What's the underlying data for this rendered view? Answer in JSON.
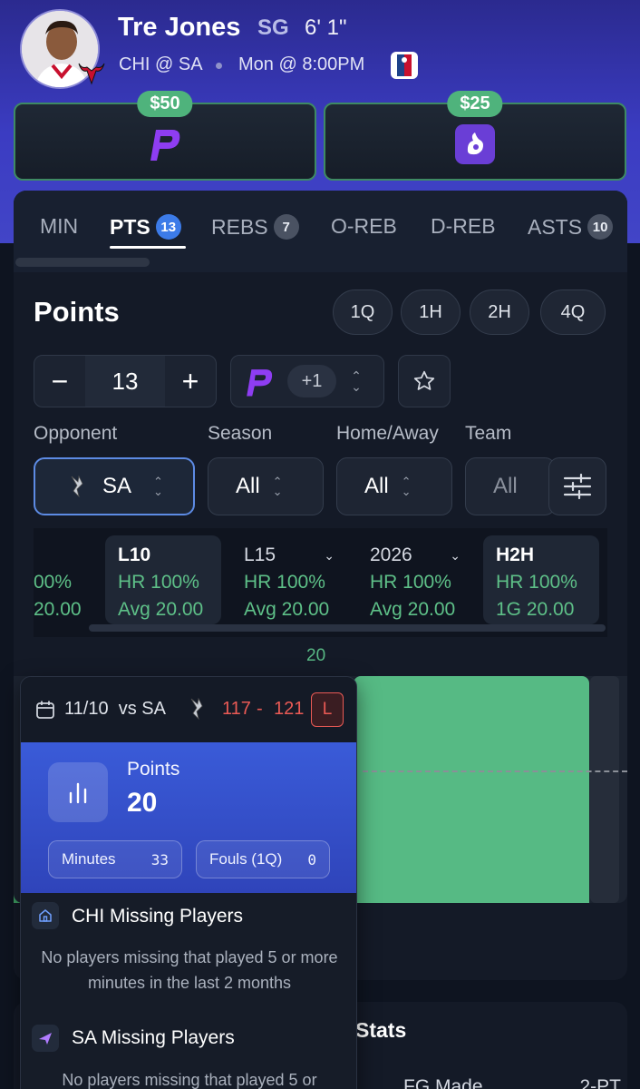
{
  "player": {
    "name": "Tre Jones",
    "position": "SG",
    "height": "6' 1\"",
    "matchup": "CHI @ SA",
    "game_time": "Mon @ 8:00PM"
  },
  "promos": [
    {
      "amount": "$50",
      "icon": "prizepicks-logo-icon"
    },
    {
      "amount": "$25",
      "icon": "underdog-logo-icon"
    }
  ],
  "tabs": [
    {
      "label": "MIN",
      "count": ""
    },
    {
      "label": "PTS",
      "count": "13"
    },
    {
      "label": "REBS",
      "count": "7"
    },
    {
      "label": "O-REB",
      "count": ""
    },
    {
      "label": "D-REB",
      "count": ""
    },
    {
      "label": "ASTS",
      "count": "10"
    }
  ],
  "section": {
    "title": "Points",
    "periods": [
      "1Q",
      "1H",
      "2H",
      "4Q"
    ]
  },
  "line": {
    "minus": "−",
    "value": "13",
    "plus": "+",
    "bump": "+1"
  },
  "filters": {
    "labels": [
      "Opponent",
      "Season",
      "Home/Away",
      "Team"
    ],
    "opponent": "SA",
    "season": "All",
    "home_away": "All",
    "team": "All"
  },
  "hit_rates": [
    {
      "title": "",
      "hr": "00%",
      "avg": "20.00"
    },
    {
      "title": "L10",
      "hr": "HR 100%",
      "avg": "Avg 20.00"
    },
    {
      "title": "L15",
      "hr": "HR 100%",
      "avg": "Avg 20.00"
    },
    {
      "title": "2026",
      "hr": "HR 100%",
      "avg": "Avg 20.00"
    },
    {
      "title": "H2H",
      "hr": "HR 100%",
      "avg": "1G 20.00"
    }
  ],
  "chart_data": {
    "type": "bar",
    "categories": [
      "11/10 vs SA"
    ],
    "values": [
      20
    ],
    "line": 13,
    "data_labels": [
      "20"
    ]
  },
  "tooltip": {
    "date": "11/10",
    "vs": "vs SA",
    "score_a": "117",
    "dash": "-",
    "score_b": "121",
    "result": "L",
    "stat_name": "Points",
    "stat_value": "20",
    "minutes_label": "Minutes",
    "minutes_value": "33",
    "fouls_label": "Fouls (1Q)",
    "fouls_value": "0",
    "chi_missing_title": "CHI Missing Players",
    "chi_missing_text": "No players missing that played 5 or more minutes in the last 2 months",
    "sa_missing_title": "SA Missing Players",
    "sa_missing_text": "No players missing that played 5 or"
  },
  "stats": {
    "title": "Stats",
    "row_label": "FG Made",
    "row_right": "2-PT"
  },
  "colors": {
    "accent_blue": "#3c7be8",
    "hit_green": "#56ba84",
    "loss_red": "#ea5a55"
  }
}
